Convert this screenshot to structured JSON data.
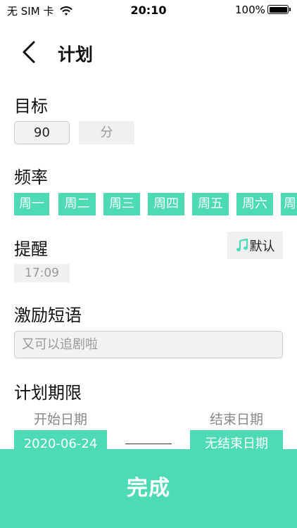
{
  "status_bar": {
    "carrier": "无 SIM 卡",
    "time": "20:10",
    "battery": "100%",
    "battery_level": 1.0
  },
  "header": {
    "title": "计划"
  },
  "goal": {
    "label": "目标",
    "value": "90",
    "unit": "分"
  },
  "frequency": {
    "label": "频率",
    "days": [
      "周一",
      "周二",
      "周三",
      "周四",
      "周五",
      "周六",
      "周日"
    ]
  },
  "reminder": {
    "label": "提醒",
    "sound_label": "默认",
    "time": "17:09"
  },
  "motivation": {
    "label": "激励短语",
    "placeholder": "又可以追剧啦"
  },
  "period": {
    "label": "计划期限",
    "start_caption": "开始日期",
    "end_caption": "结束日期",
    "start_date": "2020-06-24",
    "end_date": "无结束日期"
  },
  "footer": {
    "done_label": "完成"
  },
  "colors": {
    "accent": "#4ddbb6",
    "field_bg": "#f0f0f0"
  }
}
